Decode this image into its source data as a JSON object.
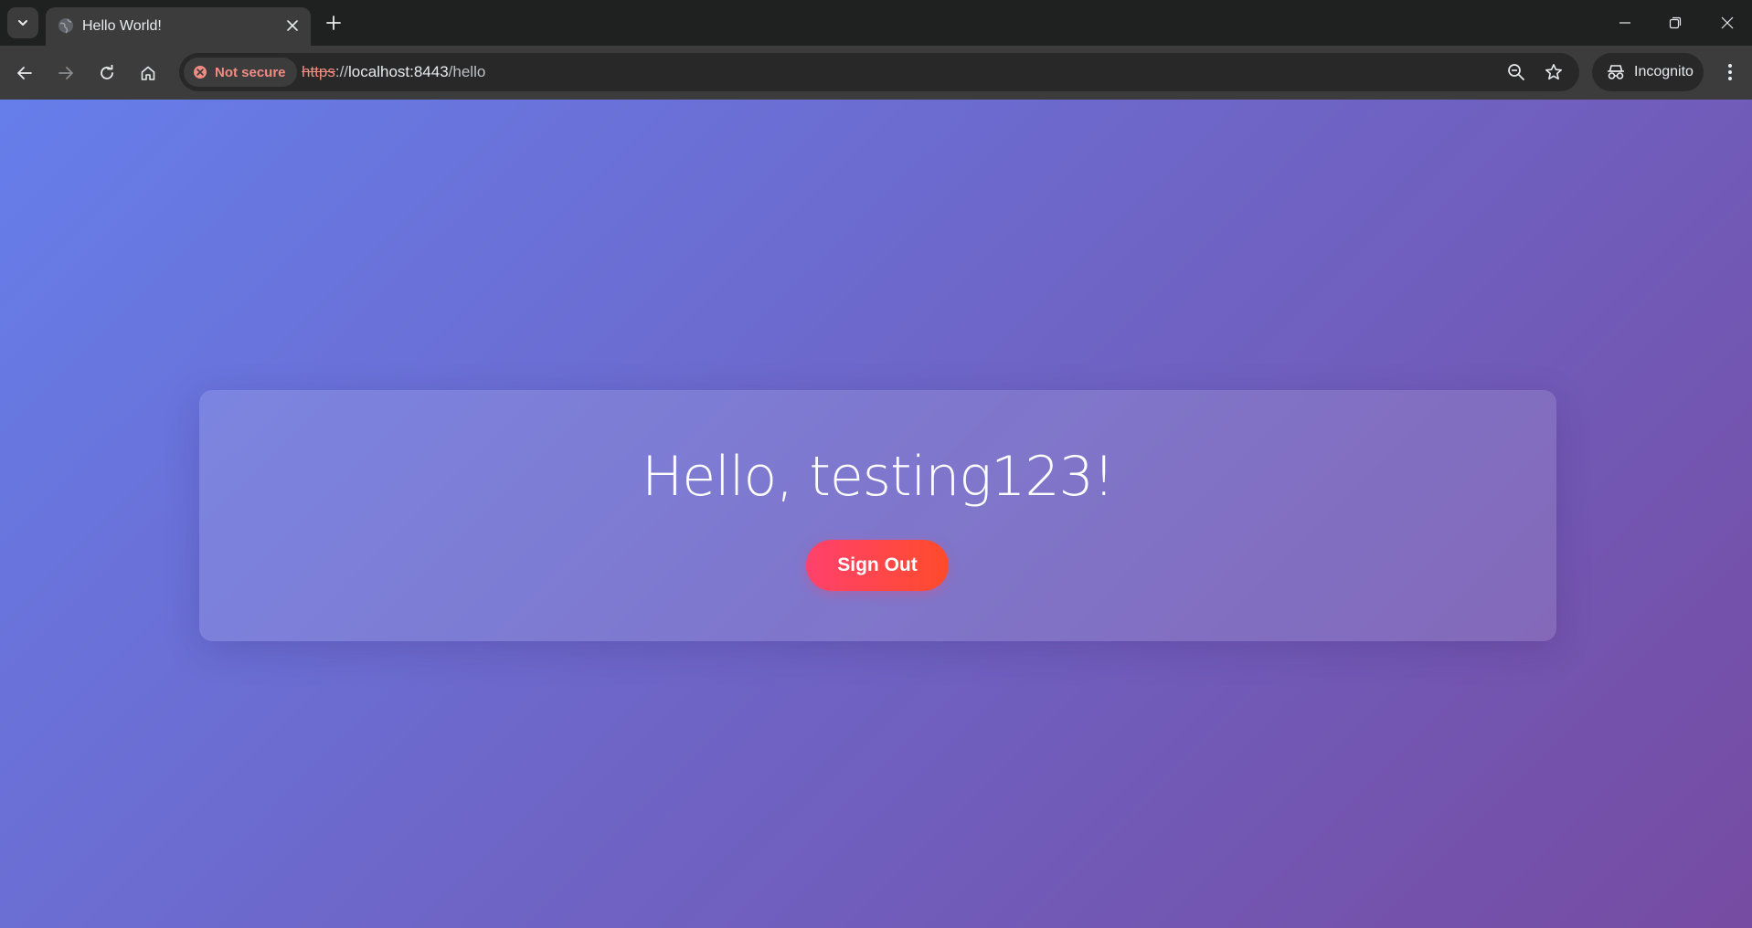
{
  "browser": {
    "tab": {
      "title": "Hello World!"
    },
    "omnibox": {
      "security_chip": "Not secure",
      "url_scheme": "https",
      "url_separator": "://",
      "url_host": "localhost:8443",
      "url_path": "/hello"
    },
    "incognito_label": "Incognito"
  },
  "page": {
    "greeting": "Hello, testing123!",
    "sign_out_label": "Sign Out"
  },
  "colors": {
    "gradient_start": "#667eea",
    "gradient_end": "#764ba2",
    "button_start": "#ff416c",
    "button_end": "#ff4b2b",
    "warning": "#f28b82"
  },
  "icons": [
    "tab-search-icon",
    "globe-icon",
    "close-icon",
    "plus-icon",
    "minimize-icon",
    "restore-icon",
    "window-close-icon",
    "back-arrow-icon",
    "forward-arrow-icon",
    "reload-icon",
    "home-icon",
    "warning-icon",
    "zoom-out-icon",
    "star-icon",
    "incognito-icon",
    "more-vert-icon"
  ]
}
